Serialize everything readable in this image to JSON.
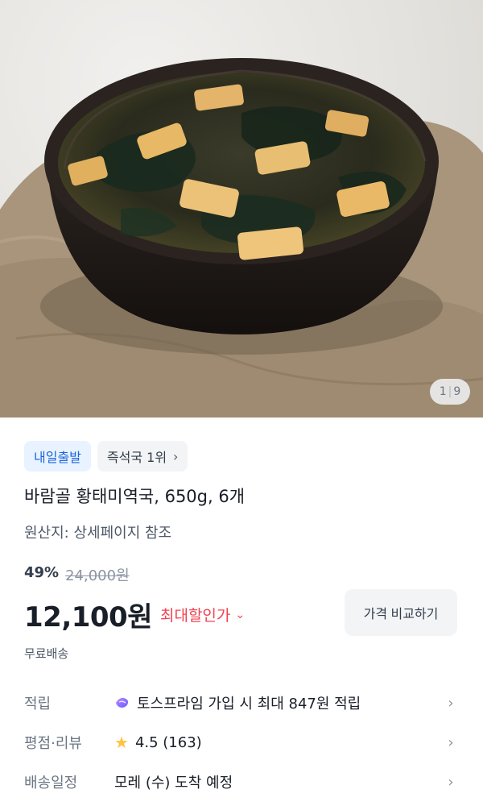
{
  "gallery": {
    "current": "1",
    "total": "9"
  },
  "badges": {
    "delivery": "내일출발",
    "rank": "즉석국 1위"
  },
  "product": {
    "title": "바람골 황태미역국, 650g, 6개",
    "origin": "원산지: 상세페이지 참조"
  },
  "pricing": {
    "discount_rate": "49%",
    "original_price": "24,000원",
    "price": "12,100원",
    "max_discount_label": "최대할인가",
    "compare_button": "가격 비교하기",
    "shipping": "무료배송"
  },
  "info": {
    "points_label": "적립",
    "points_value": "토스프라임 가입 시 최대 847원 적립",
    "rating_label": "평점·리뷰",
    "rating_value": "4.5 (163)",
    "delivery_label": "배송일정",
    "delivery_value": "모레 (수) 도착 예정"
  },
  "colors": {
    "brand_blue": "#1b64da",
    "badge_blue_bg": "#e8f3ff",
    "discount_red": "#f04452",
    "star": "#ffc342"
  },
  "icons": [
    "chevron-right-icon",
    "chevron-down-icon",
    "toss-prime-icon",
    "star-icon"
  ]
}
